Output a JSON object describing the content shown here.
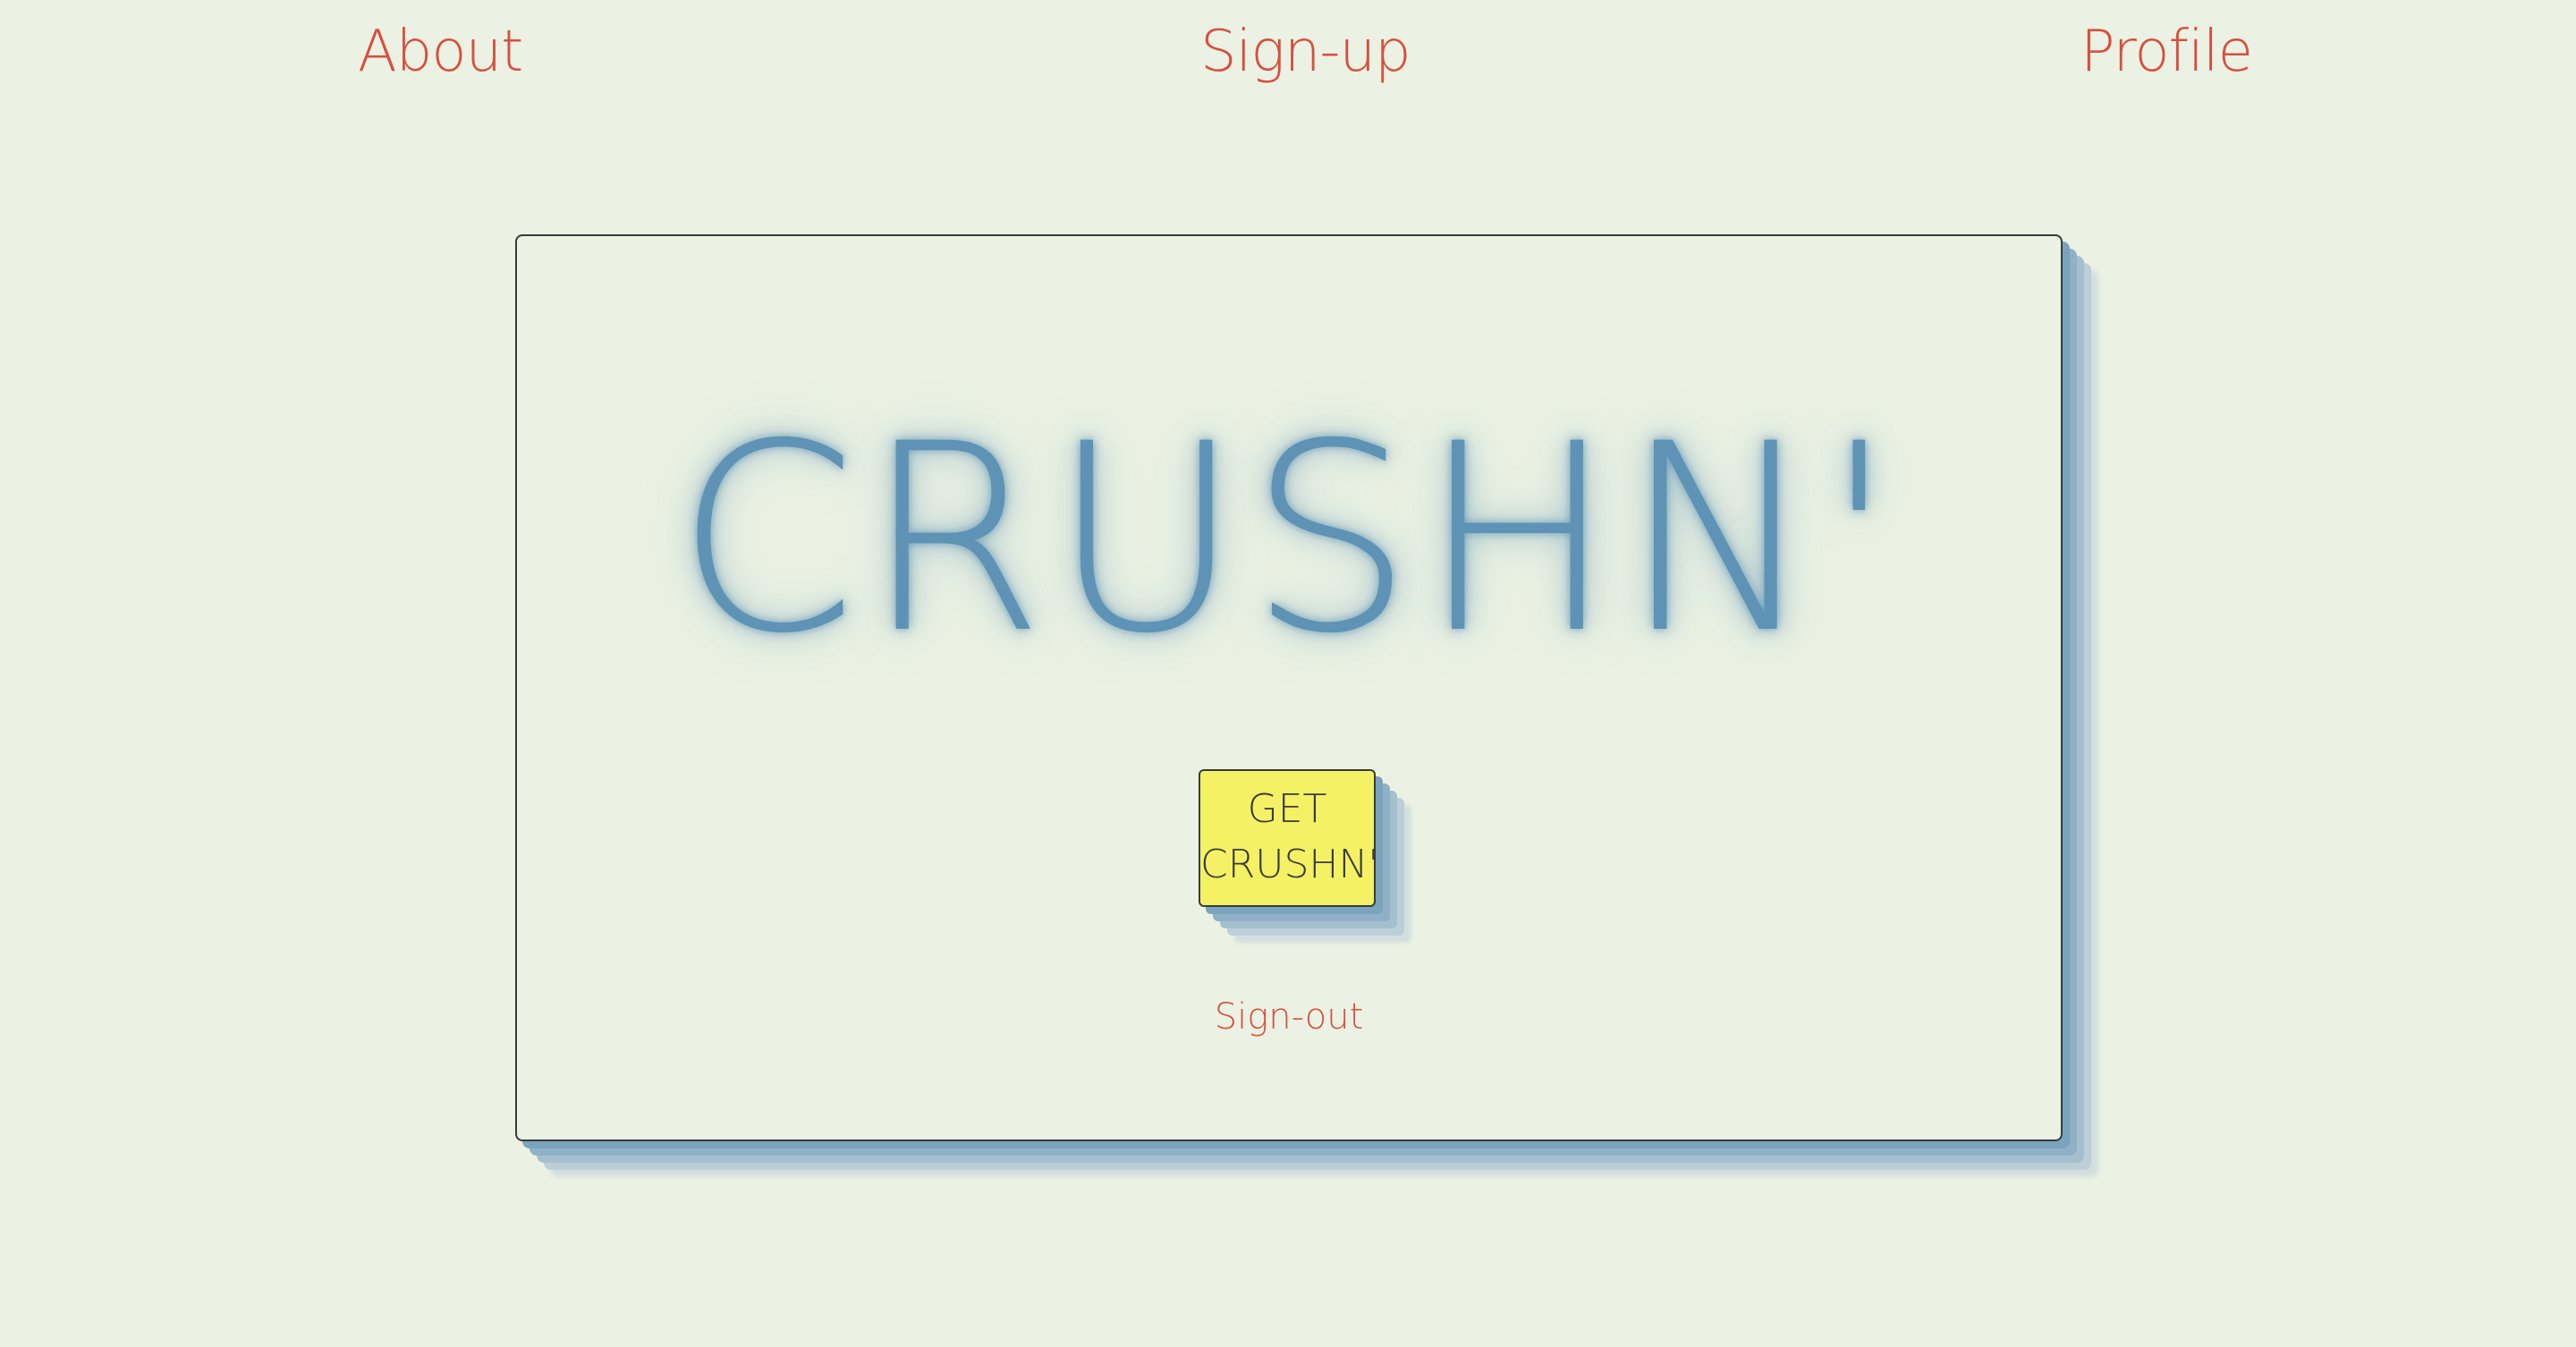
{
  "nav": {
    "about": "About",
    "signup": "Sign-up",
    "profile": "Profile"
  },
  "hero": {
    "brand": "CRUSHN'",
    "cta_line1": "GET",
    "cta_line2": "CRUSHN'",
    "signout": "Sign-out"
  },
  "colors": {
    "background": "#ebf2e4",
    "link": "#d94f3c",
    "brand": "#5e93b5",
    "button": "#f5f165",
    "shadow": "#7aa3bd"
  }
}
